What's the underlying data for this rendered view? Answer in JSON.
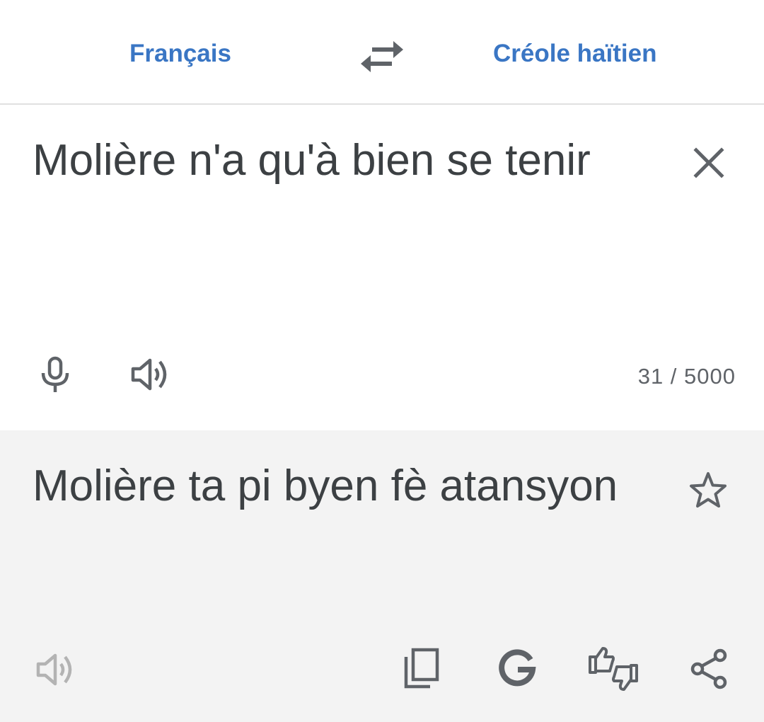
{
  "theme": {
    "accent": "#3a76c4",
    "icon_color": "#5f6368",
    "output_bg": "#f3f3f3"
  },
  "languages": {
    "source": "Français",
    "target": "Créole haïtien",
    "swap_icon": "swap-arrows-icon"
  },
  "input": {
    "text": "Molière n'a qu'à bien se tenir",
    "char_count": "31 / 5000",
    "icons": [
      "close-icon",
      "mic-icon",
      "speaker-icon"
    ]
  },
  "output": {
    "text": "Molière ta pi byen fè atansyon",
    "icons": [
      "star-icon",
      "speaker-icon",
      "copy-icon",
      "google-g-icon",
      "thumbs-feedback-icon",
      "share-icon"
    ]
  }
}
